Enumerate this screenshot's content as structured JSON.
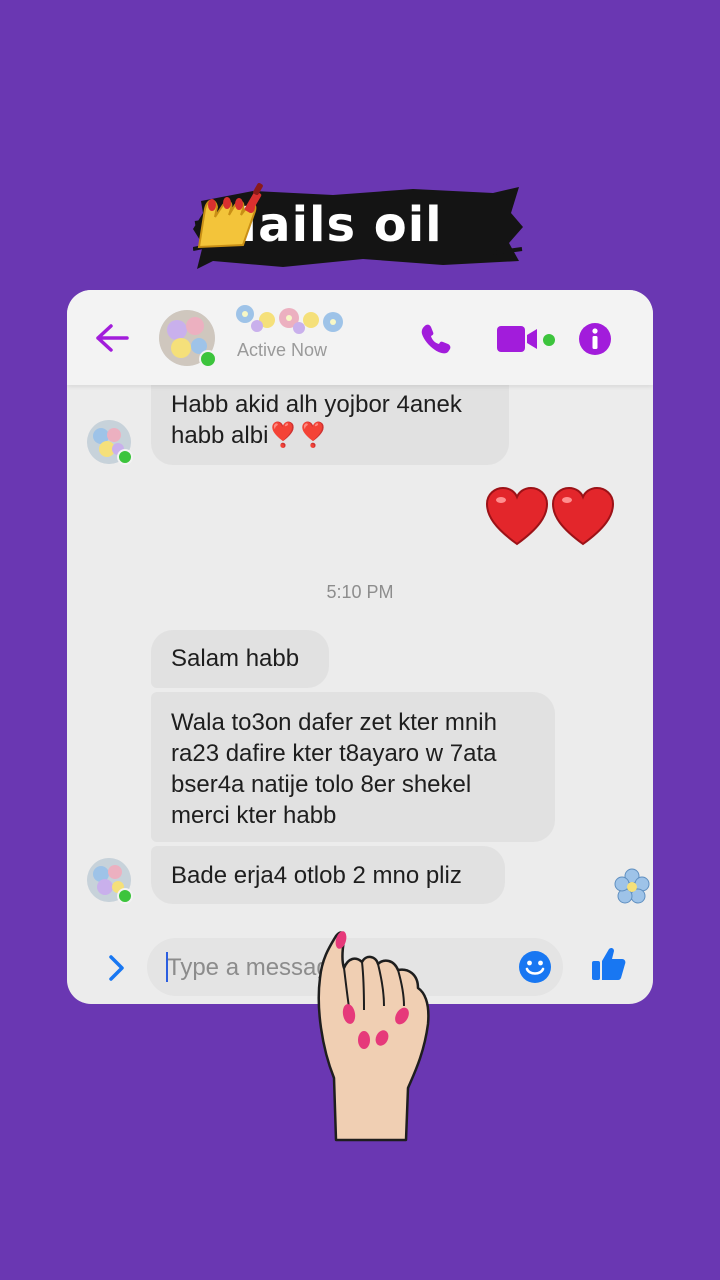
{
  "banner": {
    "title": "Nails oil"
  },
  "header": {
    "status": "Active Now",
    "icons": [
      "back-arrow-icon",
      "phone-icon",
      "video-camera-icon",
      "info-icon"
    ]
  },
  "messages": [
    {
      "from": "contact",
      "text_lines": [
        "Habb akid  alh yojbor 4anek",
        "habb albi❣️❣️"
      ]
    },
    {
      "from": "me",
      "text": "❤️❤️"
    },
    {
      "from": "contact",
      "text": "Salam habb"
    },
    {
      "from": "contact",
      "text_lines": [
        "Wala to3on dafer zet kter mnih",
        "ra23 dafire kter t8ayaro w 7ata",
        "bser4a natije tolo 8er shekel",
        "merci kter habb"
      ]
    },
    {
      "from": "contact",
      "text": "Bade erja4 otlob 2 mno pliz"
    }
  ],
  "timestamp": "5:10 PM",
  "composer": {
    "placeholder": "Type a message"
  },
  "colors": {
    "background": "#6a37b2",
    "accent": "#a21cdb",
    "bubble": "#e1e1e1",
    "online": "#3cc43c"
  }
}
